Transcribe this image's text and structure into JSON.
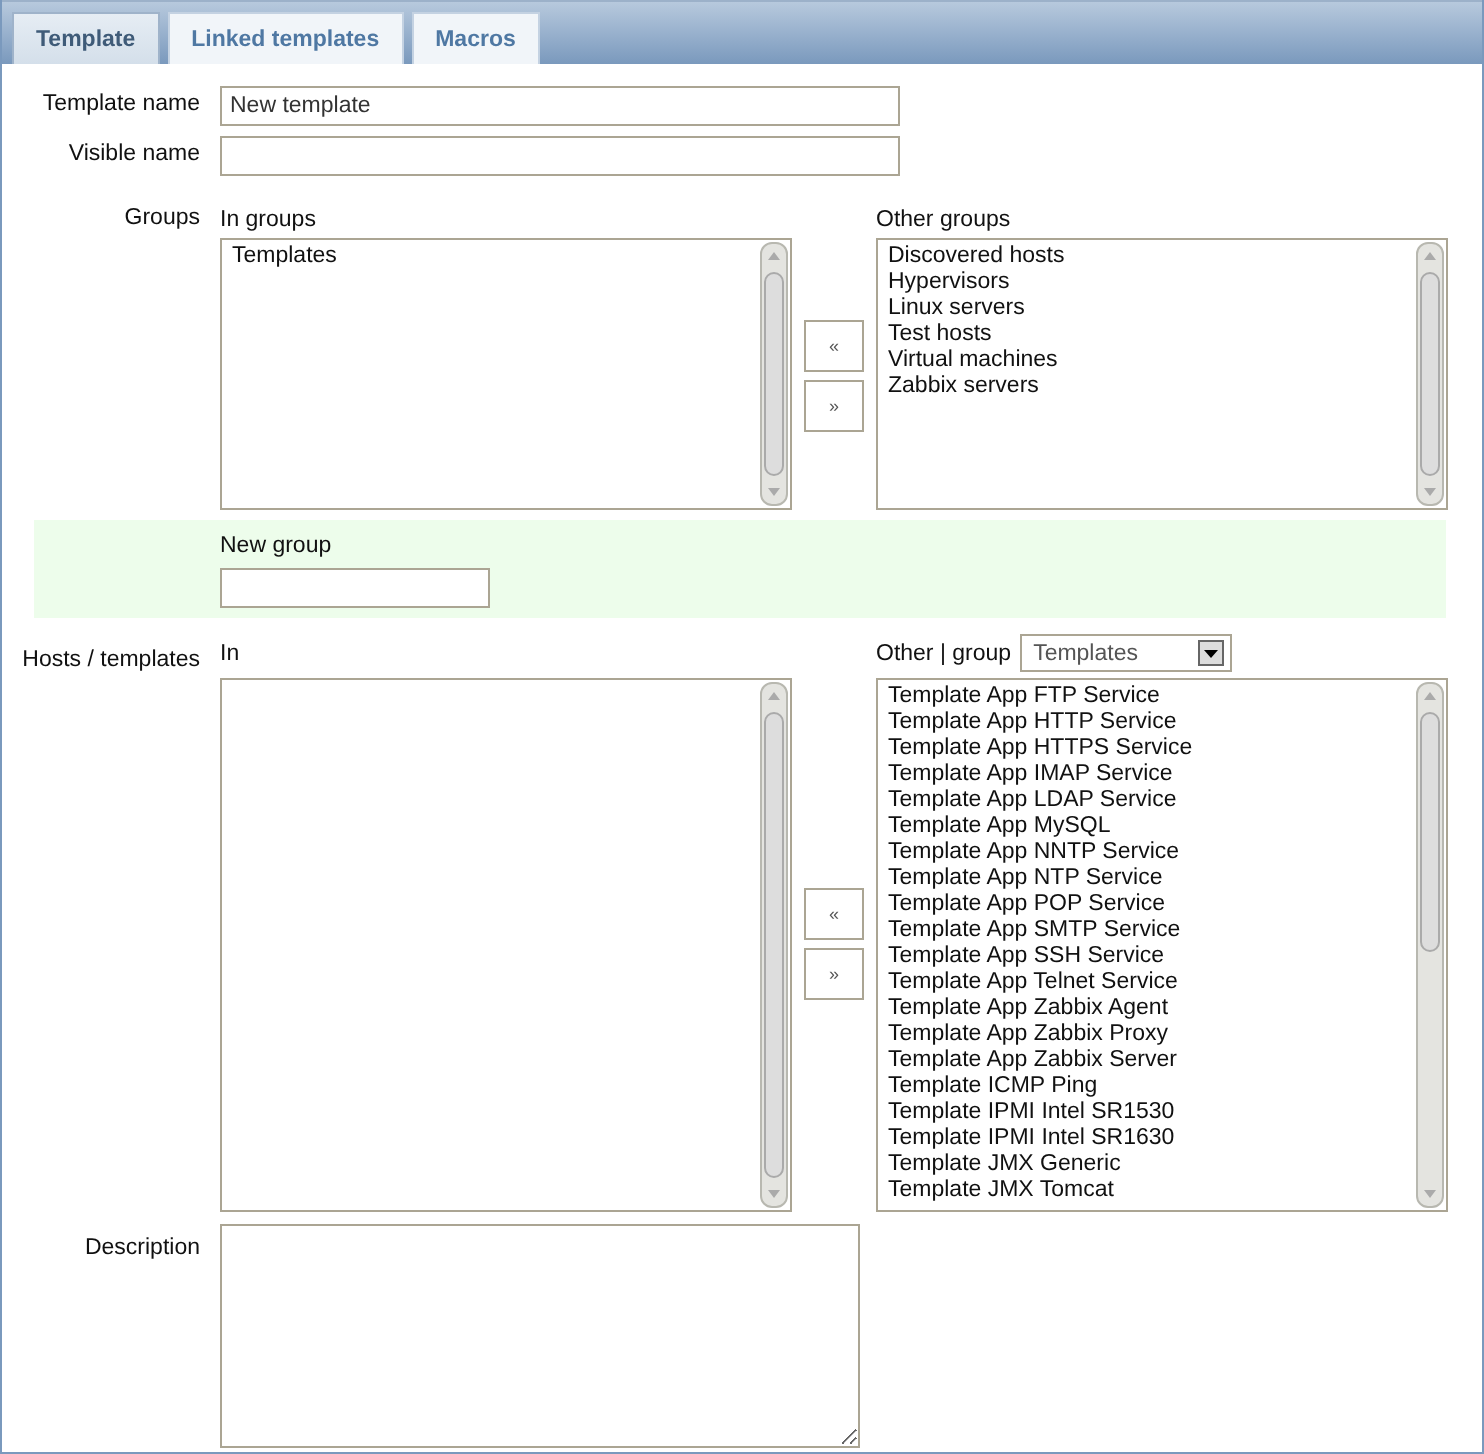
{
  "tabs": [
    {
      "label": "Template",
      "selected": true
    },
    {
      "label": "Linked templates",
      "selected": false
    },
    {
      "label": "Macros",
      "selected": false
    }
  ],
  "template_name": {
    "label": "Template name",
    "value": "New template"
  },
  "visible_name": {
    "label": "Visible name"
  },
  "groups": {
    "label": "Groups",
    "in_label": "In groups",
    "in_items": [
      "Templates"
    ],
    "move_left": "«",
    "move_right": "»",
    "other_label": "Other groups",
    "other_items": [
      "Discovered hosts",
      "Hypervisors",
      "Linux servers",
      "Test hosts",
      "Virtual machines",
      "Zabbix servers"
    ]
  },
  "new_group": {
    "label": "New group"
  },
  "hosts_templates": {
    "label": "Hosts / templates",
    "in_label": "In",
    "move_left": "«",
    "move_right": "»",
    "other_label": "Other | group",
    "group_select": "Templates",
    "other_items": [
      "Template App FTP Service",
      "Template App HTTP Service",
      "Template App HTTPS Service",
      "Template App IMAP Service",
      "Template App LDAP Service",
      "Template App MySQL",
      "Template App NNTP Service",
      "Template App NTP Service",
      "Template App POP Service",
      "Template App SMTP Service",
      "Template App SSH Service",
      "Template App Telnet Service",
      "Template App Zabbix Agent",
      "Template App Zabbix Proxy",
      "Template App Zabbix Server",
      "Template ICMP Ping",
      "Template IPMI Intel SR1530",
      "Template IPMI Intel SR1630",
      "Template JMX Generic",
      "Template JMX Tomcat"
    ]
  },
  "description": {
    "label": "Description"
  }
}
